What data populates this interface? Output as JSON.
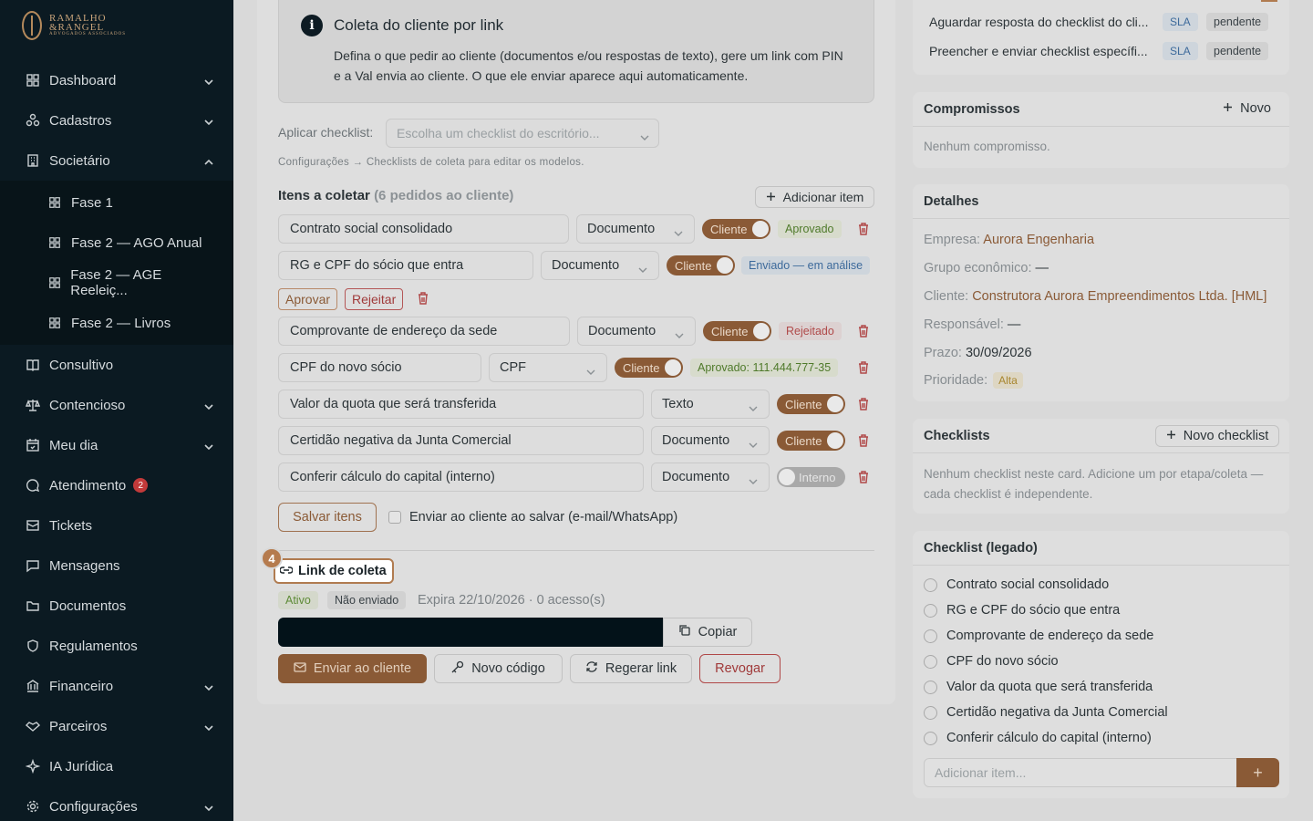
{
  "brand": {
    "line1": "RAMALHO",
    "line2": "&RANGEL",
    "line3": "ADVOGADOS ASSOCIADOS"
  },
  "sidebar": {
    "items": [
      {
        "label": "Dashboard",
        "icon": "grid-icon",
        "chevron": "down"
      },
      {
        "label": "Cadastros",
        "icon": "users-icon",
        "chevron": "down"
      },
      {
        "label": "Societário",
        "icon": "building-icon",
        "chevron": "up"
      }
    ],
    "sub_items": [
      {
        "label": "Fase 1"
      },
      {
        "label": "Fase 2 — AGO Anual"
      },
      {
        "label": "Fase 2 — AGE Reeleiç..."
      },
      {
        "label": "Fase 2 — Livros"
      }
    ],
    "items_after": [
      {
        "label": "Consultivo"
      },
      {
        "label": "Contencioso"
      },
      {
        "label": "Meu dia"
      },
      {
        "label": "Atendimento",
        "badge": "2"
      },
      {
        "label": "Tickets"
      },
      {
        "label": "Mensagens"
      },
      {
        "label": "Documentos"
      },
      {
        "label": "Regulamentos"
      },
      {
        "label": "Financeiro"
      },
      {
        "label": "Parceiros"
      },
      {
        "label": "IA Jurídica"
      },
      {
        "label": "Configurações"
      }
    ]
  },
  "coleta": {
    "title": "Coleta do cliente por link",
    "description": "Defina o que pedir ao cliente (documentos e/ou respostas de texto), gere um link com PIN e a Val envia ao cliente. O que ele enviar aparece aqui automaticamente.",
    "apply_label": "Aplicar checklist:",
    "apply_placeholder": "Escolha um checklist do escritório...",
    "config_hint": "Configurações → Checklists de coleta para editar os modelos.",
    "items_title": "Itens a coletar",
    "items_count": "(6 pedidos ao cliente)",
    "add_item": "Adicionar item",
    "items": [
      {
        "name": "Contrato social consolidado",
        "type": "Documento",
        "toggle": "Cliente",
        "status": "Aprovado"
      },
      {
        "name": "RG e CPF do sócio que entra",
        "type": "Documento",
        "toggle": "Cliente",
        "status": "Enviado — em análise"
      },
      {
        "name": "Comprovante de endereço da sede",
        "type": "Documento",
        "toggle": "Cliente",
        "status": "Rejeitado"
      },
      {
        "name": "CPF do novo sócio",
        "type": "CPF",
        "toggle": "Cliente",
        "status": "Aprovado: 111.444.777-35"
      },
      {
        "name": "Valor da quota que será transferida",
        "type": "Texto",
        "toggle": "Cliente",
        "status": ""
      },
      {
        "name": "Certidão negativa da Junta Comercial",
        "type": "Documento",
        "toggle": "Cliente",
        "status": ""
      },
      {
        "name": "Conferir cálculo do capital (interno)",
        "type": "Documento",
        "toggle": "Interno",
        "status": ""
      }
    ],
    "approve": "Aprovar",
    "reject": "Rejeitar",
    "save_items": "Salvar itens",
    "send_on_save": "Enviar ao cliente ao salvar (e-mail/WhatsApp)"
  },
  "link": {
    "step": "4",
    "title": "Link de coleta",
    "status_active": "Ativo",
    "status_sent": "Não enviado",
    "expires": "Expira 22/10/2026 · 0 acesso(s)",
    "copy": "Copiar",
    "send": "Enviar ao cliente",
    "new_code": "Novo código",
    "regen": "Regerar link",
    "revoke": "Revogar"
  },
  "tasks": [
    {
      "label": "Aguardar resposta do checklist do cli...",
      "sla": "SLA",
      "status": "pendente"
    },
    {
      "label": "Preencher e enviar checklist específi...",
      "sla": "SLA",
      "status": "pendente"
    }
  ],
  "compromissos": {
    "title": "Compromissos",
    "new": "Novo",
    "empty": "Nenhum compromisso."
  },
  "detalhes": {
    "title": "Detalhes",
    "empresa_label": "Empresa:",
    "empresa": "Aurora Engenharia",
    "grupo_label": "Grupo econômico:",
    "grupo": "—",
    "cliente_label": "Cliente:",
    "cliente": "Construtora Aurora Empreendimentos Ltda. [HML]",
    "resp_label": "Responsável:",
    "resp": "—",
    "prazo_label": "Prazo:",
    "prazo": "30/09/2026",
    "prio_label": "Prioridade:",
    "prio": "Alta"
  },
  "checklists": {
    "title": "Checklists",
    "new": "Novo checklist",
    "empty": "Nenhum checklist neste card. Adicione um por etapa/coleta — cada checklist é independente."
  },
  "legado": {
    "title": "Checklist (legado)",
    "items": [
      "Contrato social consolidado",
      "RG e CPF do sócio que entra",
      "Comprovante de endereço da sede",
      "CPF do novo sócio",
      "Valor da quota que será transferida",
      "Certidão negativa da Junta Comercial",
      "Conferir cálculo do capital (interno)"
    ],
    "add_placeholder": "Adicionar item...",
    "add_button": "+"
  },
  "colors": {
    "sidebar": "#0b1a22",
    "accent": "#8a5a36",
    "danger": "#a03a3a"
  }
}
